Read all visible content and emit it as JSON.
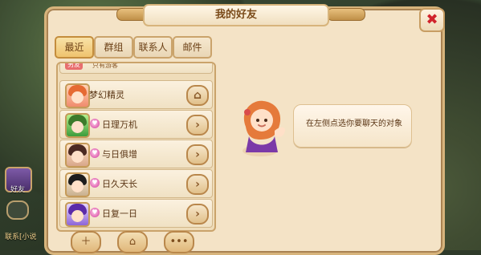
{
  "hud": {
    "friends_label": "好友",
    "chat_snippet": "联系[小说"
  },
  "window": {
    "title": "我的好友",
    "close_symbol": "✖"
  },
  "tabs": [
    {
      "label": "最近",
      "active": true
    },
    {
      "label": "群组",
      "active": false
    },
    {
      "label": "联系人",
      "active": false
    },
    {
      "label": "邮件",
      "active": false
    }
  ],
  "list": {
    "partial_top": {
      "tag": "另友",
      "text": "只有游客"
    },
    "rows": [
      {
        "name": "梦幻精灵",
        "has_fav": false,
        "button_icon": "home-icon",
        "button_symbol": "⌂"
      },
      {
        "name": "日理万机",
        "has_fav": true,
        "button_icon": "chevron-right-icon",
        "button_symbol": "›"
      },
      {
        "name": "与日俱增",
        "has_fav": true,
        "button_icon": "chevron-right-icon",
        "button_symbol": "›"
      },
      {
        "name": "日久天长",
        "has_fav": true,
        "button_icon": "chevron-right-icon",
        "button_symbol": "›"
      },
      {
        "name": "日复一日",
        "has_fav": true,
        "button_icon": "chevron-right-icon",
        "button_symbol": "›"
      }
    ]
  },
  "chat": {
    "hint": "在左侧点选你要聊天的对象"
  },
  "bottom_buttons": [
    {
      "name": "add-friend-button",
      "symbol": "＋"
    },
    {
      "name": "home-button",
      "symbol": "⌂"
    },
    {
      "name": "more-button",
      "symbol": "•••"
    }
  ],
  "colors": {
    "panel_bg": "#f4e3c6",
    "border_gold": "#caa36b",
    "title_text": "#7a4a19",
    "close_red": "#d0232b",
    "tab_active": "#efc36e"
  }
}
